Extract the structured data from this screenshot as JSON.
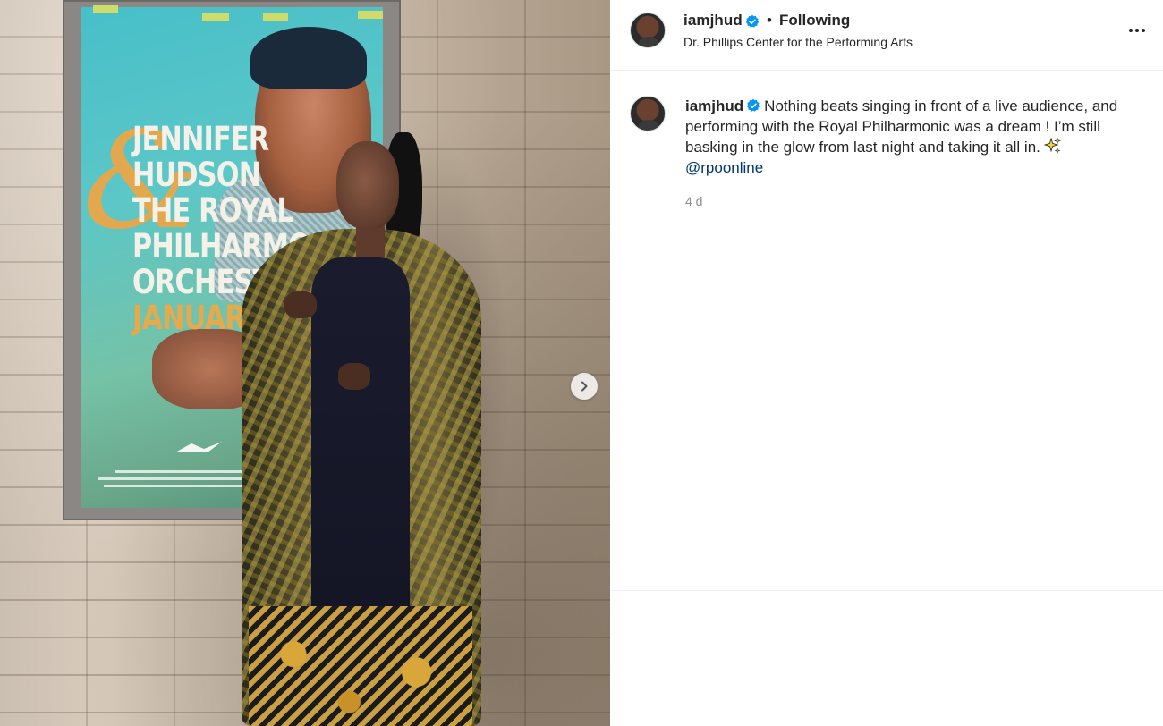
{
  "post": {
    "media": {
      "poster": {
        "headline_lines": [
          "JENNIFER",
          "HUDSON",
          "THE ROYAL",
          "PHILHARMONIC",
          "ORCHESTRA"
        ],
        "ampersand": "&",
        "month": "JANUARY"
      }
    },
    "header": {
      "username": "iamjhud",
      "separator": "•",
      "follow_status": "Following",
      "location": "Dr. Phillips Center for the Performing Arts"
    },
    "caption": {
      "username": "iamjhud",
      "text": "Nothing beats singing in front of a live audience, and performing with the Royal Philharmonic was a dream ! I’m still basking in the glow from last night and taking it all in.",
      "mention": "@rpoonline",
      "timestamp": "4 d"
    }
  },
  "icons": {
    "verified": "verified-badge-icon",
    "next": "chevron-right-icon",
    "more": "more-options-icon",
    "sparkle": "sparkles-emoji"
  },
  "colors": {
    "verified_blue": "#0095f6",
    "mention_blue": "#00376b",
    "timestamp_gray": "#8e8e8e",
    "text": "#262626"
  }
}
